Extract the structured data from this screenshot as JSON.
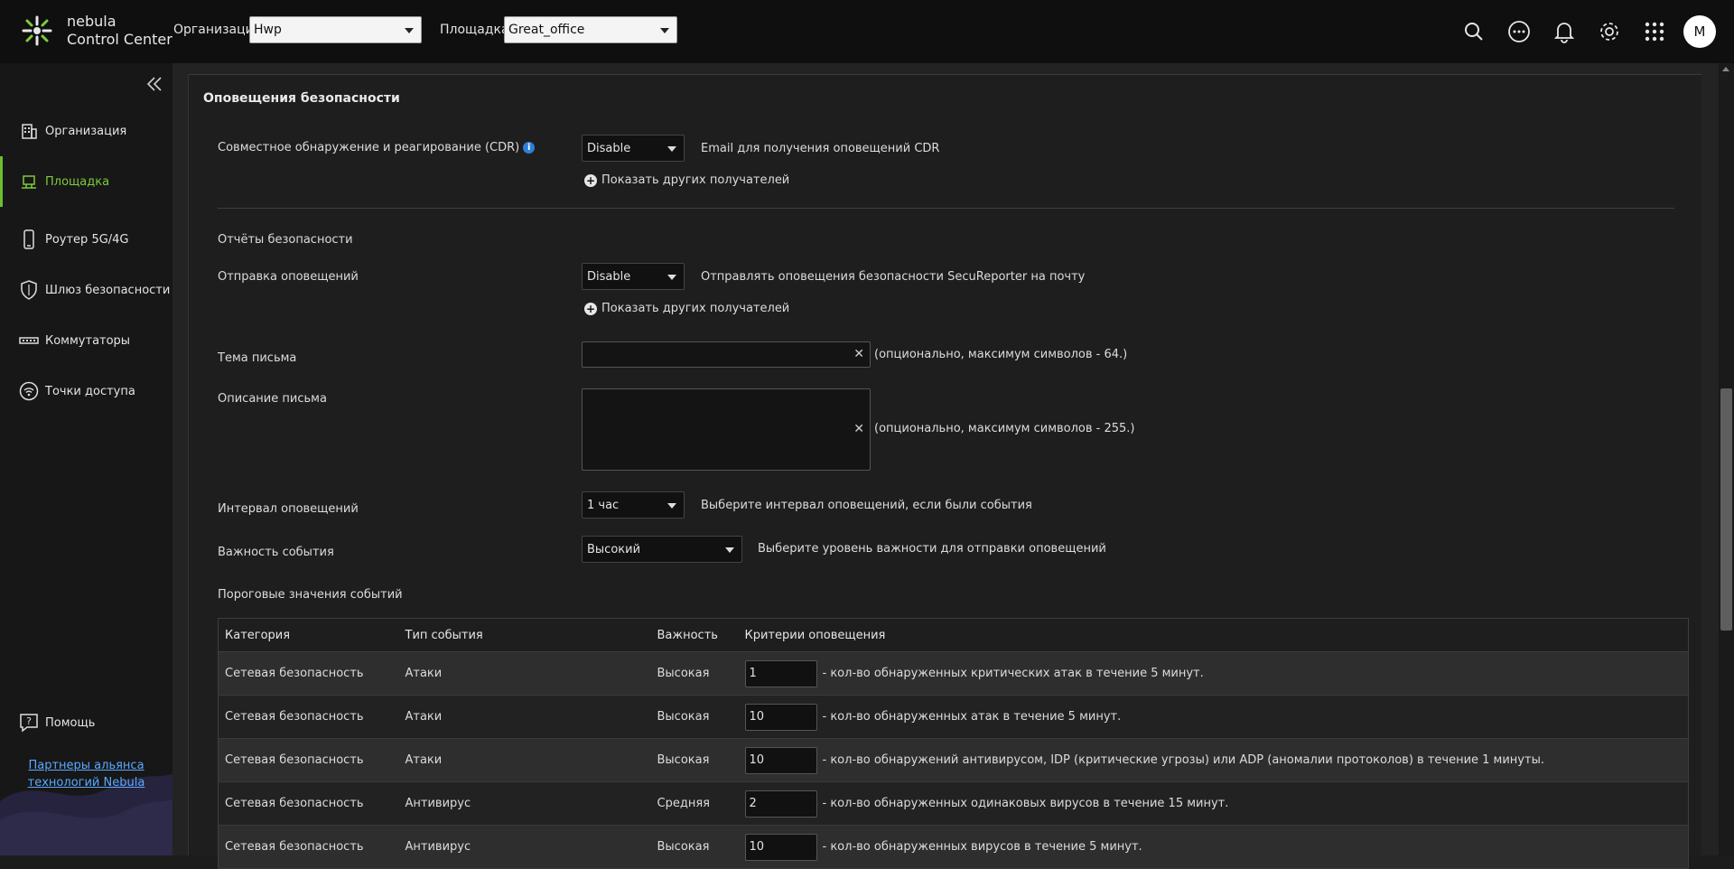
{
  "app": {
    "brand_line1": "nebula",
    "brand_line2": "Control Center"
  },
  "topbar": {
    "org_label": "Организация:",
    "org_value": "Hwp",
    "site_label": "Площадка:",
    "site_value": "Great_office",
    "avatar_letter": "M",
    "icons": [
      "search-icon",
      "more-icon",
      "bell-icon",
      "gear-icon",
      "apps-grid-icon"
    ]
  },
  "sidebar": {
    "items": [
      {
        "label": "Организация",
        "icon": "building-icon"
      },
      {
        "label": "Площадка",
        "icon": "site-icon",
        "active": true
      },
      {
        "label": "Роутер 5G/4G",
        "icon": "phone-icon"
      },
      {
        "label": "Шлюз безопасности",
        "icon": "shield-icon"
      },
      {
        "label": "Коммутаторы",
        "icon": "switch-icon"
      },
      {
        "label": "Точки доступа",
        "icon": "access-point-icon"
      }
    ],
    "help": "Помощь",
    "partners_line1": "Партнеры альянса",
    "partners_line2": "технологий Nebula"
  },
  "section": {
    "title": "Оповещения безопасности",
    "cdr_label": "Совместное обнаружение и реагирование (CDR)",
    "cdr_value": "Disable",
    "cdr_desc": "Email для получения оповещений CDR",
    "show_more_1": "Показать других получателей",
    "reports_title": "Отчёты безопасности",
    "send_label": "Отправка оповещений",
    "send_value": "Disable",
    "send_desc": "Отправлять оповещения безопасности SecuReporter на почту",
    "show_more_2": "Показать других получателей",
    "subject_label": "Тема письма",
    "subject_value": "",
    "subject_hint": "(опционально, максимум символов - 64.)",
    "desc_label": "Описание письма",
    "desc_value": "",
    "desc_hint": "(опционально, максимум символов - 255.)",
    "interval_label": "Интервал оповещений",
    "interval_value": "1 час",
    "interval_desc": "Выберите интервал оповещений, если были события",
    "severity_label": "Важность события",
    "severity_value": "Высокий",
    "severity_desc": "Выберите уровень важности для отправки оповещений",
    "thresholds_title": "Пороговые значения событий"
  },
  "table": {
    "headers": [
      "Категория",
      "Тип события",
      "Важность",
      "Критерии оповещения"
    ],
    "rows": [
      {
        "category": "Сетевая безопасность",
        "type": "Атаки",
        "severity": "Высокая",
        "value": "1",
        "criteria": "- кол-во обнаруженных критических атак в течение 5 минут."
      },
      {
        "category": "Сетевая безопасность",
        "type": "Атаки",
        "severity": "Высокая",
        "value": "10",
        "criteria": "- кол-во обнаруженных атак в течение 5 минут."
      },
      {
        "category": "Сетевая безопасность",
        "type": "Атаки",
        "severity": "Высокая",
        "value": "10",
        "criteria": "- кол-во обнаружений антивирусом, IDP (критические угрозы) или ADP (аномалии протоколов) в течение 1 минуты."
      },
      {
        "category": "Сетевая безопасность",
        "type": "Антивирус",
        "severity": "Средняя",
        "value": "2",
        "criteria": "- кол-во обнаруженных одинаковых вирусов в течение 15 минут."
      },
      {
        "category": "Сетевая безопасность",
        "type": "Антивирус",
        "severity": "Высокая",
        "value": "10",
        "criteria": "- кол-во обнаруженных вирусов в течение 5 минут."
      }
    ]
  },
  "colors": {
    "accent": "#6cbf2c",
    "link": "#5aa8ff",
    "info": "#2f7fd8"
  }
}
